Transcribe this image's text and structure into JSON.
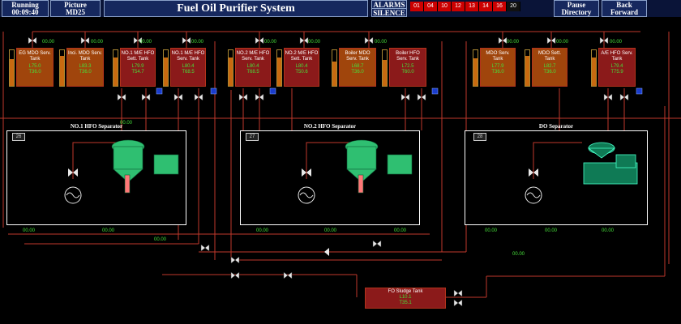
{
  "header": {
    "running_label": "Running",
    "running_time": "00:09:40",
    "picture_label": "Picture",
    "picture_code": "MD25",
    "title": "Fuel Oil Purifier System",
    "alarms_label": "ALARMS",
    "silence_label": "SILENCE",
    "alarm_numbers": [
      "01",
      "04",
      "10",
      "12",
      "13",
      "14",
      "16",
      "20"
    ],
    "pause_label": "Pause",
    "directory_label": "Directory",
    "back_label": "Back",
    "forward_label": "Forward"
  },
  "tanks": [
    {
      "name": "EG MDO Serv. Tank",
      "l": "L75.0",
      "t": "T36.0",
      "level": 0.75
    },
    {
      "name": "Inci. MDO Serv. Tank",
      "l": "L83.3",
      "t": "T36.0",
      "level": 0.83
    },
    {
      "name": "NO.1 M/E HFO Sett. Tank",
      "l": "L79.9",
      "t": "T54.7",
      "level": 0.8
    },
    {
      "name": "NO.1 M/E HFO Serv. Tank",
      "l": "L80.4",
      "t": "T68.5",
      "level": 0.8
    },
    {
      "name": "NO.2 M/E HFO Serv. Tank",
      "l": "L80.4",
      "t": "T68.5",
      "level": 0.8
    },
    {
      "name": "NO.2 M/E HFO Sett. Tank",
      "l": "L80.4",
      "t": "T50.6",
      "level": 0.8
    },
    {
      "name": "Boiler MDO Serv. Tank",
      "l": "L68.7",
      "t": "T36.0",
      "level": 0.69
    },
    {
      "name": "Boiler HFO Serv. Tank",
      "l": "L72.5",
      "t": "T60.0",
      "level": 0.73
    },
    {
      "name": "MDO Serv. Tank",
      "l": "L77.9",
      "t": "T36.0",
      "level": 0.78
    },
    {
      "name": "MDO Sett. Tank",
      "l": "L82.7",
      "t": "T36.0",
      "level": 0.83
    },
    {
      "name": "A/E HFO Serv. Tank",
      "l": "L79.4",
      "t": "T75.9",
      "level": 0.79
    }
  ],
  "separators": [
    {
      "label": "NO.1 HFO Separator",
      "num": "26"
    },
    {
      "label": "NO.2 HFO Separator",
      "num": "27"
    },
    {
      "label": "DO Separator",
      "num": "28"
    }
  ],
  "sludge_tank": {
    "name": "FO Sludge Tank",
    "l": "L10.1",
    "t": "T35.1"
  },
  "flow_value": "00.00",
  "colors": {
    "pipe": "#c0392b",
    "tank_hfo": "#8b1a1a",
    "tank_mdo": "#a0450c",
    "sep_green": "#2fbf71",
    "text_green": "#46e03a",
    "valve": "#e8e8e8"
  }
}
